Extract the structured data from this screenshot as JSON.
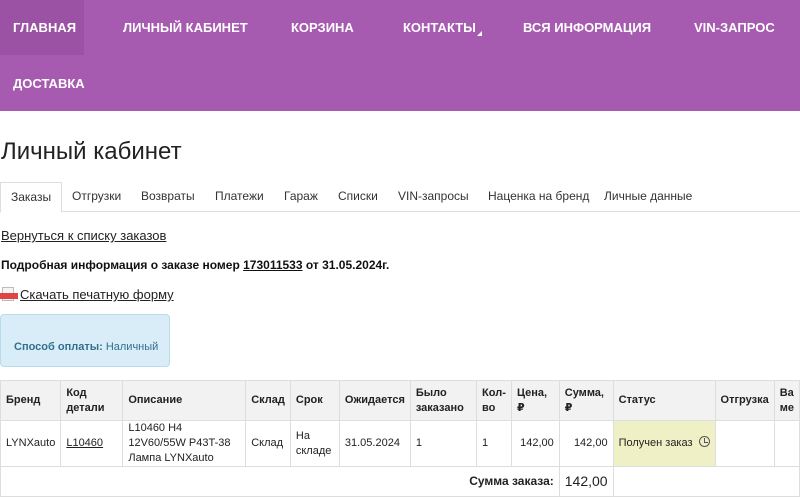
{
  "nav": {
    "items": [
      "ГЛАВНАЯ",
      "ЛИЧНЫЙ КАБИНЕТ",
      "КОРЗИНА",
      "КОНТАКТЫ",
      "ВСЯ ИНФОРМАЦИЯ",
      "VIN-ЗАПРОС",
      "ДОСТАВКА"
    ],
    "accent": "#a65bb0"
  },
  "page": {
    "title": "Личный кабинет"
  },
  "tabs": [
    "Заказы",
    "Отгрузки",
    "Возвраты",
    "Платежи",
    "Гараж",
    "Списки",
    "VIN-запросы",
    "Наценка на бренд",
    "Личные данные"
  ],
  "order": {
    "back_link": "Вернуться к списку заказов",
    "info_prefix": "Подробная информация о заказе номер",
    "number": "173011533",
    "info_suffix": "от 31.05.2024г.",
    "print_link": "Скачать печатную форму",
    "payment_label": "Способ оплаты:",
    "payment_value": "Наличный"
  },
  "table": {
    "headers": [
      "Бренд",
      "Код детали",
      "Описание",
      "Склад",
      "Срок",
      "Ожидается",
      "Было заказано",
      "Кол-во",
      "Цена, ₽",
      "Сумма, ₽",
      "Статус",
      "Отгрузка",
      "Ва ме"
    ],
    "rows": [
      {
        "brand": "LYNXauto",
        "code": "L10460",
        "description": "L10460 H4 12V60/55W P43T-38 Лампа LYNXauto",
        "warehouse": "Склад",
        "term": "На складе",
        "expected": "31.05.2024",
        "ordered": "1",
        "qty": "1",
        "price": "142,00",
        "sum": "142,00",
        "status": "Получен заказ",
        "shipment": "",
        "extra": ""
      }
    ],
    "total_label": "Сумма заказа:",
    "total_value": "142,00"
  }
}
